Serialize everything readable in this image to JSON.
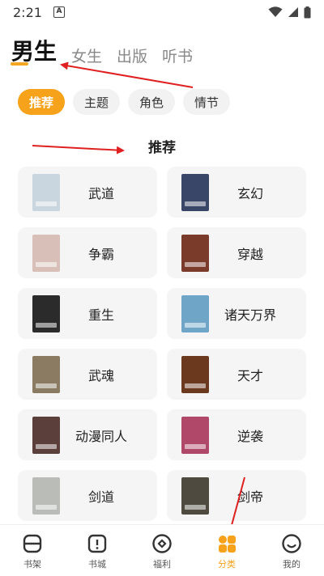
{
  "status_bar": {
    "time": "2:21",
    "notification_letter": "A"
  },
  "top_tabs": [
    {
      "label": "男生",
      "active": true
    },
    {
      "label": "女生",
      "active": false
    },
    {
      "label": "出版",
      "active": false
    },
    {
      "label": "听书",
      "active": false
    }
  ],
  "chips": [
    {
      "label": "推荐",
      "active": true
    },
    {
      "label": "主题",
      "active": false
    },
    {
      "label": "角色",
      "active": false
    },
    {
      "label": "情节",
      "active": false
    }
  ],
  "section_title": "推荐",
  "categories": [
    {
      "label": "武道",
      "cover_color": "#c9d6e0"
    },
    {
      "label": "玄幻",
      "cover_color": "#3a4668"
    },
    {
      "label": "争霸",
      "cover_color": "#d8c0b8"
    },
    {
      "label": "穿越",
      "cover_color": "#7a3b2a"
    },
    {
      "label": "重生",
      "cover_color": "#2b2b2b"
    },
    {
      "label": "诸天万界",
      "cover_color": "#6fa6c8"
    },
    {
      "label": "武魂",
      "cover_color": "#8a7b62"
    },
    {
      "label": "天才",
      "cover_color": "#6b3a1e"
    },
    {
      "label": "动漫同人",
      "cover_color": "#5a3f3a"
    },
    {
      "label": "逆袭",
      "cover_color": "#b0486a"
    },
    {
      "label": "剑道",
      "cover_color": "#b9bcb7"
    },
    {
      "label": "剑帝",
      "cover_color": "#4f4a3f"
    }
  ],
  "bottom_nav": [
    {
      "label": "书架",
      "icon": "bookshelf-icon",
      "active": false
    },
    {
      "label": "书城",
      "icon": "bookstore-icon",
      "active": false
    },
    {
      "label": "福利",
      "icon": "welfare-icon",
      "active": false
    },
    {
      "label": "分类",
      "icon": "category-icon",
      "active": true
    },
    {
      "label": "我的",
      "icon": "profile-icon",
      "active": false
    }
  ],
  "colors": {
    "accent": "#f7a21b",
    "annotation_arrow": "#e02020"
  }
}
